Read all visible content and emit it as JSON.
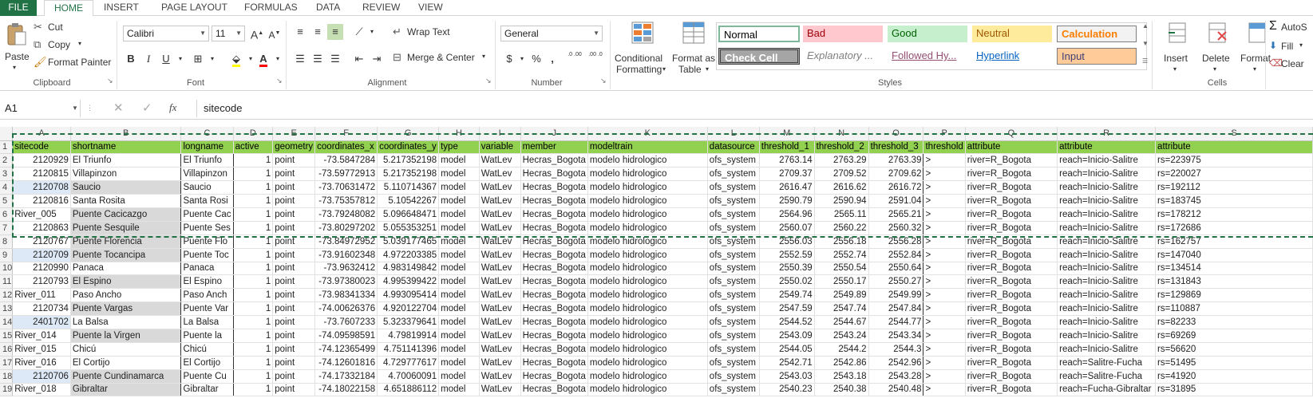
{
  "tabs": [
    "FILE",
    "HOME",
    "INSERT",
    "PAGE LAYOUT",
    "FORMULAS",
    "DATA",
    "REVIEW",
    "VIEW"
  ],
  "ribbon": {
    "clipboard": {
      "paste": "Paste",
      "cut": "Cut",
      "copy": "Copy",
      "format_painter": "Format Painter",
      "label": "Clipboard"
    },
    "font": {
      "name": "Calibri",
      "size": "11",
      "bold": "B",
      "italic": "I",
      "underline": "U",
      "grow": "A",
      "shrink": "A",
      "label": "Font"
    },
    "alignment": {
      "wrap_text": "Wrap Text",
      "merge_center": "Merge & Center",
      "label": "Alignment"
    },
    "number": {
      "format": "General",
      "currency": "$",
      "percent": "%",
      "comma": ",",
      "inc_dec": ".0 .00",
      "dec_dec": ".00 .0",
      "label": "Number"
    },
    "styles": {
      "conditional_1": "Conditional",
      "conditional_2": "Formatting",
      "format_table_1": "Format as",
      "format_table_2": "Table",
      "cells": [
        "Normal",
        "Bad",
        "Good",
        "Neutral",
        "Calculation",
        "Check Cell",
        "Explanatory ...",
        "Followed Hy...",
        "Hyperlink",
        "Input"
      ],
      "label": "Styles"
    },
    "cells": {
      "insert": "Insert",
      "delete": "Delete",
      "format": "Format",
      "label": "Cells"
    },
    "editing": {
      "autosum": "AutoS",
      "fill": "Fill",
      "clear": "Clear"
    },
    "colors": {
      "accent": "#217346",
      "normal_border": "#7fb89b",
      "bad_bg": "#ffc7ce",
      "bad_fg": "#9c0006",
      "good_bg": "#c6efce",
      "good_fg": "#006100",
      "neutral_bg": "#ffeb9c",
      "neutral_fg": "#9c5700",
      "calc_bg": "#f2f2f2",
      "calc_fg": "#fa7d00",
      "check_bg": "#a5a5a5",
      "input_bg": "#ffcc99",
      "input_fg": "#3f3f76"
    }
  },
  "formula_bar": {
    "name_box": "A1",
    "fx": "fx",
    "content": "sitecode"
  },
  "columns": [
    "A",
    "B",
    "C",
    "D",
    "E",
    "F",
    "G",
    "H",
    "I",
    "J",
    "K",
    "L",
    "M",
    "N",
    "O",
    "P",
    "Q",
    "R",
    "S"
  ],
  "header_row": [
    "sitecode",
    "shortname",
    "longname",
    "active",
    "geometry",
    "coordinates_x",
    "coordinates_y",
    "type",
    "variable",
    "member",
    "modeltrain",
    "datasource",
    "threshold_1",
    "threshold_2",
    "threshold_3",
    "threshold",
    "attribute",
    "attribute",
    "attribute"
  ],
  "rows": [
    [
      "2120929",
      "El Triunfo",
      "El Triunfo",
      "1",
      "point",
      "-73.5847284",
      "5.217352198",
      "model",
      "WatLev",
      "Hecras_Bogota",
      "modelo hidrologico",
      "ofs_system",
      "2763.14",
      "2763.29",
      "2763.39",
      ">",
      "river=R_Bogota",
      "reach=Inicio-Salitre",
      "rs=223975"
    ],
    [
      "2120815",
      "Villapinzon",
      "Villapinzon",
      "1",
      "point",
      "-73.59772913",
      "5.217352198",
      "model",
      "WatLev",
      "Hecras_Bogota",
      "modelo hidrologico",
      "ofs_system",
      "2709.37",
      "2709.52",
      "2709.62",
      ">",
      "river=R_Bogota",
      "reach=Inicio-Salitre",
      "rs=220027"
    ],
    [
      "2120708",
      "Saucio",
      "Saucio",
      "1",
      "point",
      "-73.70631472",
      "5.110714367",
      "model",
      "WatLev",
      "Hecras_Bogota",
      "modelo hidrologico",
      "ofs_system",
      "2616.47",
      "2616.62",
      "2616.72",
      ">",
      "river=R_Bogota",
      "reach=Inicio-Salitre",
      "rs=192112"
    ],
    [
      "2120816",
      "Santa Rosita",
      "Santa Rosi",
      "1",
      "point",
      "-73.75357812",
      "5.10542267",
      "model",
      "WatLev",
      "Hecras_Bogota",
      "modelo hidrologico",
      "ofs_system",
      "2590.79",
      "2590.94",
      "2591.04",
      ">",
      "river=R_Bogota",
      "reach=Inicio-Salitre",
      "rs=183745"
    ],
    [
      "River_005",
      "Puente Cacicazgo",
      "Puente Cac",
      "1",
      "point",
      "-73.79248082",
      "5.096648471",
      "model",
      "WatLev",
      "Hecras_Bogota",
      "modelo hidrologico",
      "ofs_system",
      "2564.96",
      "2565.11",
      "2565.21",
      ">",
      "river=R_Bogota",
      "reach=Inicio-Salitre",
      "rs=178212"
    ],
    [
      "2120863",
      "Puente Sesquile",
      "Puente Ses",
      "1",
      "point",
      "-73.80297202",
      "5.055353251",
      "model",
      "WatLev",
      "Hecras_Bogota",
      "modelo hidrologico",
      "ofs_system",
      "2560.07",
      "2560.22",
      "2560.32",
      ">",
      "river=R_Bogota",
      "reach=Inicio-Salitre",
      "rs=172686"
    ],
    [
      "2120767",
      "Puente Florencia",
      "Puente Flo",
      "1",
      "point",
      "-73.84972952",
      "5.039177465",
      "model",
      "WatLev",
      "Hecras_Bogota",
      "modelo hidrologico",
      "ofs_system",
      "2556.03",
      "2556.18",
      "2556.28",
      ">",
      "river=R_Bogota",
      "reach=Inicio-Salitre",
      "rs=162757"
    ],
    [
      "2120709",
      "Puente Tocancipa",
      "Puente Toc",
      "1",
      "point",
      "-73.91602348",
      "4.972203385",
      "model",
      "WatLev",
      "Hecras_Bogota",
      "modelo hidrologico",
      "ofs_system",
      "2552.59",
      "2552.74",
      "2552.84",
      ">",
      "river=R_Bogota",
      "reach=Inicio-Salitre",
      "rs=147040"
    ],
    [
      "2120990",
      "Panaca",
      "Panaca",
      "1",
      "point",
      "-73.9632412",
      "4.983149842",
      "model",
      "WatLev",
      "Hecras_Bogota",
      "modelo hidrologico",
      "ofs_system",
      "2550.39",
      "2550.54",
      "2550.64",
      ">",
      "river=R_Bogota",
      "reach=Inicio-Salitre",
      "rs=134514"
    ],
    [
      "2120793",
      "El Espino",
      "El Espino",
      "1",
      "point",
      "-73.97380023",
      "4.995399422",
      "model",
      "WatLev",
      "Hecras_Bogota",
      "modelo hidrologico",
      "ofs_system",
      "2550.02",
      "2550.17",
      "2550.27",
      ">",
      "river=R_Bogota",
      "reach=Inicio-Salitre",
      "rs=131843"
    ],
    [
      "River_011",
      "Paso Ancho",
      "Paso Anch",
      "1",
      "point",
      "-73.98341334",
      "4.993095414",
      "model",
      "WatLev",
      "Hecras_Bogota",
      "modelo hidrologico",
      "ofs_system",
      "2549.74",
      "2549.89",
      "2549.99",
      ">",
      "river=R_Bogota",
      "reach=Inicio-Salitre",
      "rs=129869"
    ],
    [
      "2120734",
      "Puente Vargas",
      "Puente Var",
      "1",
      "point",
      "-74.00626376",
      "4.920122704",
      "model",
      "WatLev",
      "Hecras_Bogota",
      "modelo hidrologico",
      "ofs_system",
      "2547.59",
      "2547.74",
      "2547.84",
      ">",
      "river=R_Bogota",
      "reach=Inicio-Salitre",
      "rs=110887"
    ],
    [
      "2401702",
      "La Balsa",
      "La Balsa",
      "1",
      "point",
      "-73.7607233",
      "5.323379641",
      "model",
      "WatLev",
      "Hecras_Bogota",
      "modelo hidrologico",
      "ofs_system",
      "2544.52",
      "2544.67",
      "2544.77",
      ">",
      "river=R_Bogota",
      "reach=Inicio-Salitre",
      "rs=82233"
    ],
    [
      "River_014",
      "Puente la Virgen",
      "Puente la",
      "1",
      "point",
      "-74.09598591",
      "4.79819914",
      "model",
      "WatLev",
      "Hecras_Bogota",
      "modelo hidrologico",
      "ofs_system",
      "2543.09",
      "2543.24",
      "2543.34",
      ">",
      "river=R_Bogota",
      "reach=Inicio-Salitre",
      "rs=69269"
    ],
    [
      "River_015",
      "Chicú",
      "Chicú",
      "1",
      "point",
      "-74.12365499",
      "4.751141396",
      "model",
      "WatLev",
      "Hecras_Bogota",
      "modelo hidrologico",
      "ofs_system",
      "2544.05",
      "2544.2",
      "2544.3",
      ">",
      "river=R_Bogota",
      "reach=Inicio-Salitre",
      "rs=56620"
    ],
    [
      "River_016",
      "El Cortijo",
      "El Cortijo",
      "1",
      "point",
      "-74.12601816",
      "4.729777617",
      "model",
      "WatLev",
      "Hecras_Bogota",
      "modelo hidrologico",
      "ofs_system",
      "2542.71",
      "2542.86",
      "2542.96",
      ">",
      "river=R_Bogota",
      "reach=Salitre-Fucha",
      "rs=51495"
    ],
    [
      "2120706",
      "Puente Cundinamarca",
      "Puente Cu",
      "1",
      "point",
      "-74.17332184",
      "4.70060091",
      "model",
      "WatLev",
      "Hecras_Bogota",
      "modelo hidrologico",
      "ofs_system",
      "2543.03",
      "2543.18",
      "2543.28",
      ">",
      "river=R_Bogota",
      "reach=Salitre-Fucha",
      "rs=41920"
    ],
    [
      "River_018",
      "Gibraltar",
      "Gibraltar",
      "1",
      "point",
      "-74.18022158",
      "4.651886112",
      "model",
      "WatLev",
      "Hecras_Bogota",
      "modelo hidrologico",
      "ofs_system",
      "2540.23",
      "2540.38",
      "2540.48",
      ">",
      "river=R_Bogota",
      "reach=Fucha-Gibraltar",
      "rs=31895"
    ]
  ]
}
